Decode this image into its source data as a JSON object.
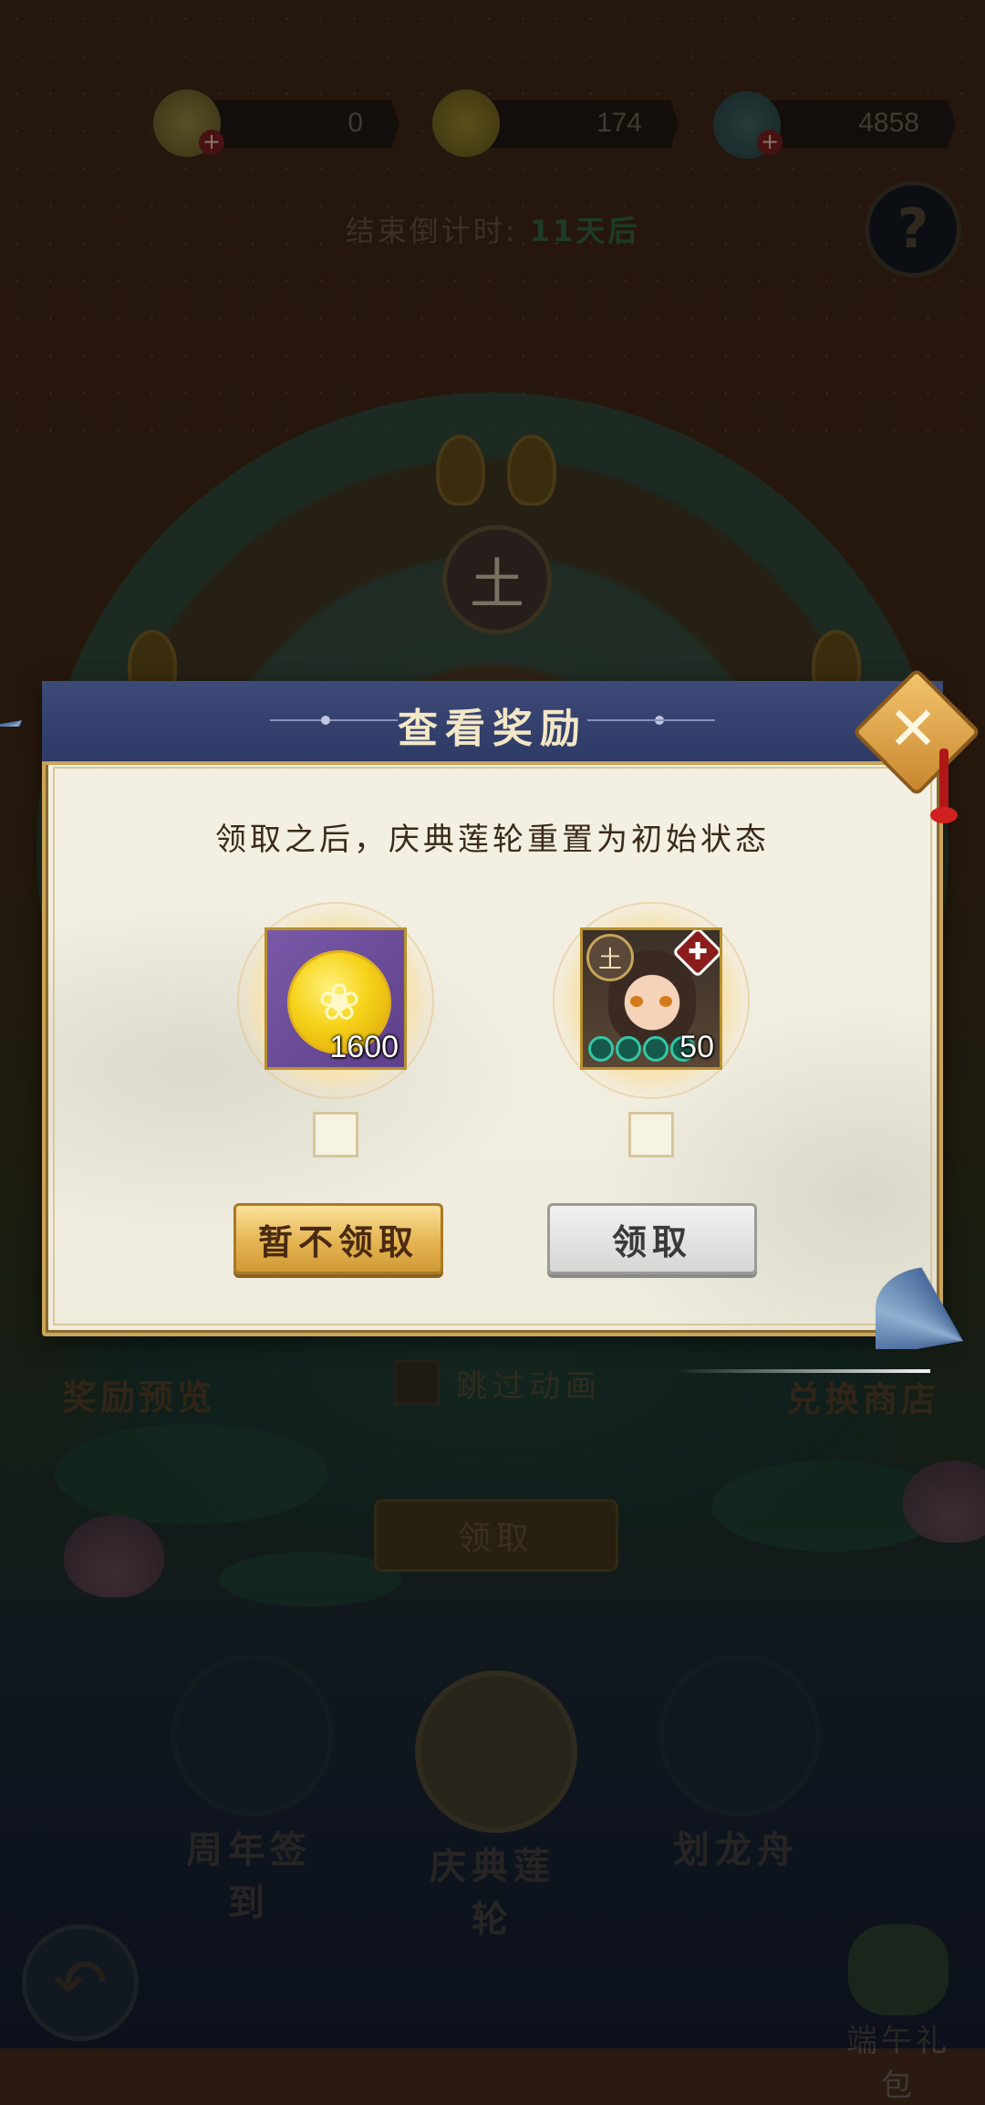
{
  "currency": [
    {
      "icon": "gem-pouch-icon",
      "value": "0",
      "has_plus": true
    },
    {
      "icon": "gold-coin-icon",
      "value": "174",
      "has_plus": false
    },
    {
      "icon": "jade-shell-icon",
      "value": "4858",
      "has_plus": true
    }
  ],
  "countdown": {
    "label": "结束倒计时:",
    "value": "11天后"
  },
  "help_label": "?",
  "background": {
    "wheel_center": "土",
    "reward_preview": "奖励预览",
    "skip_animation": "跳过动画",
    "exchange_shop": "兑换商店",
    "claim": "领取"
  },
  "nav": [
    {
      "label": "周年签到",
      "icon": "anniversary-signin-icon"
    },
    {
      "label": "庆典莲轮",
      "icon": "lotus-wheel-icon"
    },
    {
      "label": "划龙舟",
      "icon": "dragon-boat-icon"
    }
  ],
  "gift_label": "端午礼包",
  "back_icon": "back-arrow-icon",
  "dialog": {
    "title": "查看奖励",
    "description": "领取之后，庆典莲轮重置为初始状态",
    "close_icon": "close-x-icon",
    "rewards": [
      {
        "type": "gold-coin",
        "count": "1600",
        "icon": "gold-coin-icon"
      },
      {
        "type": "hero",
        "count": "50",
        "element": "土",
        "icon": "hero-portrait-icon"
      }
    ],
    "decline_button": "暂不领取",
    "claim_button": "领取"
  },
  "colors": {
    "dialog_header": "#34406e",
    "gold_accent": "#c9a45a",
    "coin_yellow": "#f6d21a",
    "gold_card_bg": "#6b4c99"
  }
}
